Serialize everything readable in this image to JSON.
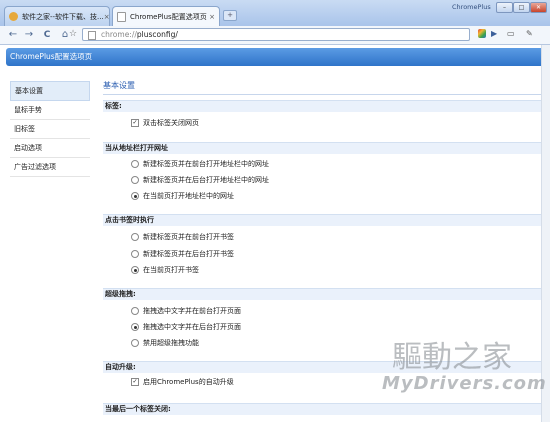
{
  "tabs": [
    {
      "title": "软件之家--软件下载、技...",
      "close": "×"
    },
    {
      "title": "ChromePlus配置选项页",
      "close": "×"
    }
  ],
  "new_tab": "+",
  "window": {
    "brand": "ChromePlus",
    "min": "–",
    "max": "□",
    "close": "✕"
  },
  "toolbar": {
    "back": "←",
    "forward": "→",
    "reload": "C",
    "home": "⌂",
    "star": "☆",
    "play": "▶",
    "page_menu": "▭",
    "tools_menu": "✎"
  },
  "omnibox": {
    "scheme": "chrome://",
    "path": "plusconfig/"
  },
  "header": {
    "title": "ChromePlus配置选项页"
  },
  "sidebar": {
    "items": [
      "基本设置",
      "鼠标手势",
      "旧标签",
      "启动选项",
      "广告过滤选项"
    ]
  },
  "main": {
    "title": "基本设置",
    "sections": [
      {
        "heading": "标签:",
        "options": [
          {
            "label": "双击标签关闭网页",
            "type": "checkbox",
            "checked": true
          }
        ]
      },
      {
        "heading": "当从地址栏打开网址",
        "options": [
          {
            "label": "新建标签页并在前台打开地址栏中的网址",
            "type": "radio",
            "checked": false
          },
          {
            "label": "新建标签页并在后台打开地址栏中的网址",
            "type": "radio",
            "checked": false
          },
          {
            "label": "在当前页打开地址栏中的网址",
            "type": "radio",
            "checked": true
          }
        ]
      },
      {
        "heading": "点击书签时执行",
        "options": [
          {
            "label": "新建标签页并在前台打开书签",
            "type": "radio",
            "checked": false
          },
          {
            "label": "新建标签页并在后台打开书签",
            "type": "radio",
            "checked": false
          },
          {
            "label": "在当前页打开书签",
            "type": "radio",
            "checked": true
          }
        ]
      },
      {
        "heading": "超级拖拽:",
        "options": [
          {
            "label": "拖拽选中文字并在前台打开页面",
            "type": "radio",
            "checked": false
          },
          {
            "label": "拖拽选中文字并在后台打开页面",
            "type": "radio",
            "checked": true
          },
          {
            "label": "禁用超级拖拽功能",
            "type": "radio",
            "checked": false
          }
        ]
      },
      {
        "heading": "自动升级:",
        "options": [
          {
            "label": "启用ChromePlus的自动升级",
            "type": "checkbox",
            "checked": true
          }
        ]
      },
      {
        "heading": "当最后一个标签关闭:",
        "options": []
      }
    ]
  },
  "watermark": {
    "line1": "驅動之家",
    "line2": "MyDrivers.com"
  }
}
